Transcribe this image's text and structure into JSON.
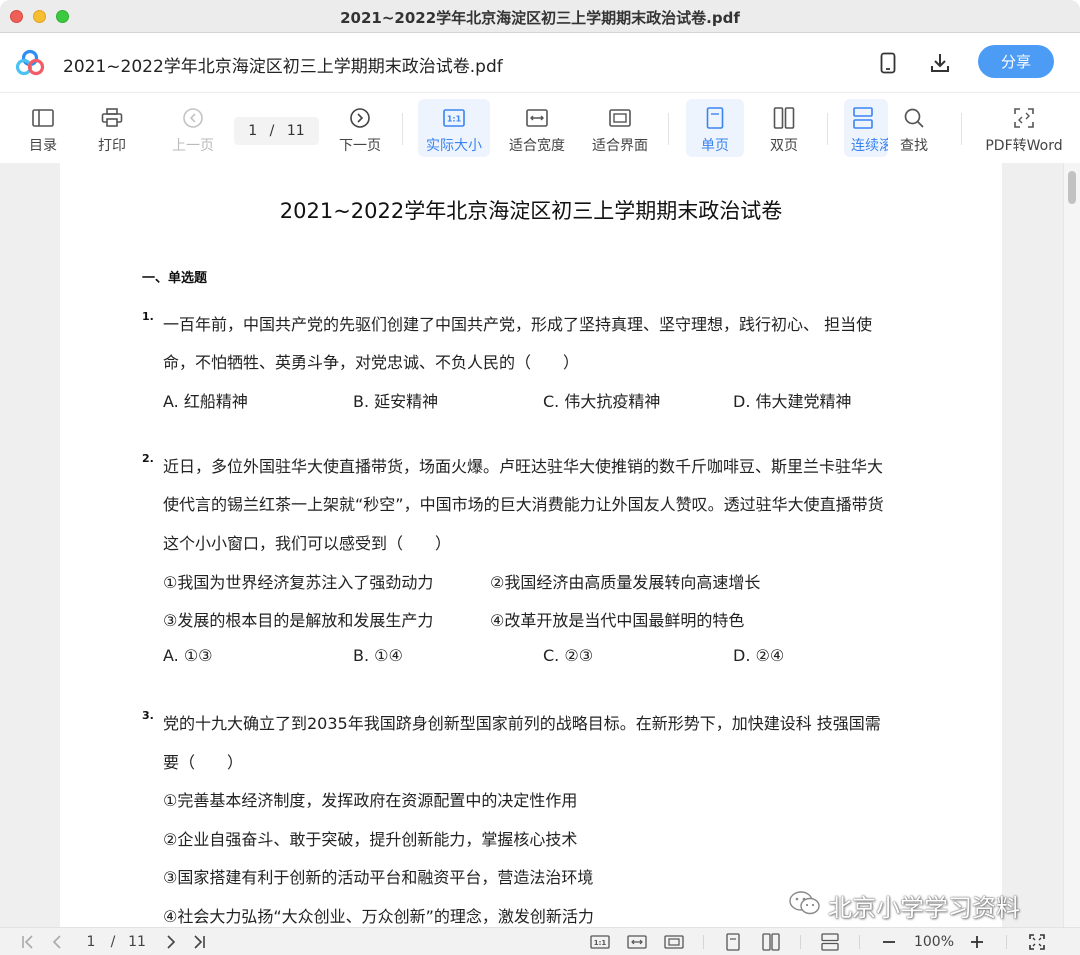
{
  "window": {
    "title": "2021~2022学年北京海淀区初三上学期期末政治试卷.pdf"
  },
  "header": {
    "doc_title": "2021~2022学年北京海淀区初三上学期期末政治试卷.pdf",
    "share_label": "分享"
  },
  "toolbar": {
    "toc": "目录",
    "print": "打印",
    "prev": "上一页",
    "page_current": "1",
    "page_sep": "/",
    "page_total": "11",
    "next": "下一页",
    "actual_size": "实际大小",
    "fit_width": "适合宽度",
    "fit_window": "适合界面",
    "single_page": "单页",
    "double_page": "双页",
    "continuous": "连续滚",
    "find": "查找",
    "pdf_to_word": "PDF转Word",
    "actual_size_glyph": "1:1"
  },
  "document": {
    "title": "2021~2022学年北京海淀区初三上学期期末政治试卷",
    "section": "一、单选题",
    "questions": [
      {
        "num": "1.",
        "lines": [
          "一百年前，中国共产党的先驱们创建了中国共产党，形成了坚持真理、坚守理想，践行初心、 担当使",
          "命，不怕牺牲、英勇斗争，对党忠诚、不负人民的（　　）"
        ],
        "choices": [
          "A. 红船精神",
          "B. 延安精神",
          "C. 伟大抗疫精神",
          "D. 伟大建党精神"
        ]
      },
      {
        "num": "2.",
        "lines": [
          "近日，多位外国驻华大使直播带货，场面火爆。卢旺达驻华大使推销的数千斤咖啡豆、斯里兰卡驻华大",
          "使代言的锡兰红茶一上架就“秒空”，中国市场的巨大消费能力让外国友人赞叹。透过驻华大使直播带货",
          "这个小小窗口，我们可以感受到（　　）"
        ],
        "statements": [
          "①我国为世界经济复苏注入了强劲动力",
          "②我国经济由高质量发展转向高速增长",
          "③发展的根本目的是解放和发展生产力",
          "④改革开放是当代中国最鲜明的特色"
        ],
        "choices": [
          "A. ①③",
          "B. ①④",
          "C. ②③",
          "D. ②④"
        ]
      },
      {
        "num": "3.",
        "lines": [
          "党的十九大确立了到2035年我国跻身创新型国家前列的战略目标。在新形势下，加快建设科 技强国需",
          "要（　　）",
          "①完善基本经济制度，发挥政府在资源配置中的决定性作用",
          "②企业自强奋斗、敢于突破，提升创新能力，掌握核心技术",
          "③国家搭建有利于创新的活动平台和融资平台，营造法治环境",
          "④社会大力弘扬“大众创业、万众创新”的理念，激发创新活力"
        ]
      }
    ]
  },
  "watermark": "北京小学学习资料",
  "statusbar": {
    "page_current": "1",
    "page_sep": "/",
    "page_total": "11",
    "zoom": "100%",
    "actual_size_glyph": "1:1"
  },
  "colors": {
    "accent": "#4c9bf5",
    "active_bg": "#eef4fe",
    "active_text": "#3a84f0",
    "page_bg": "#efefef"
  },
  "icons": [
    "logo-icon",
    "phone-icon",
    "download-icon",
    "toc-icon",
    "print-icon",
    "prev-page-icon",
    "next-page-icon",
    "actual-size-icon",
    "fit-width-icon",
    "fit-window-icon",
    "single-page-icon",
    "double-page-icon",
    "continuous-icon",
    "search-icon",
    "pdf-to-word-icon",
    "first-page-icon",
    "prev-icon",
    "next-icon",
    "last-page-icon",
    "zoom-out-icon",
    "zoom-in-icon",
    "fullscreen-icon",
    "wechat-icon"
  ]
}
